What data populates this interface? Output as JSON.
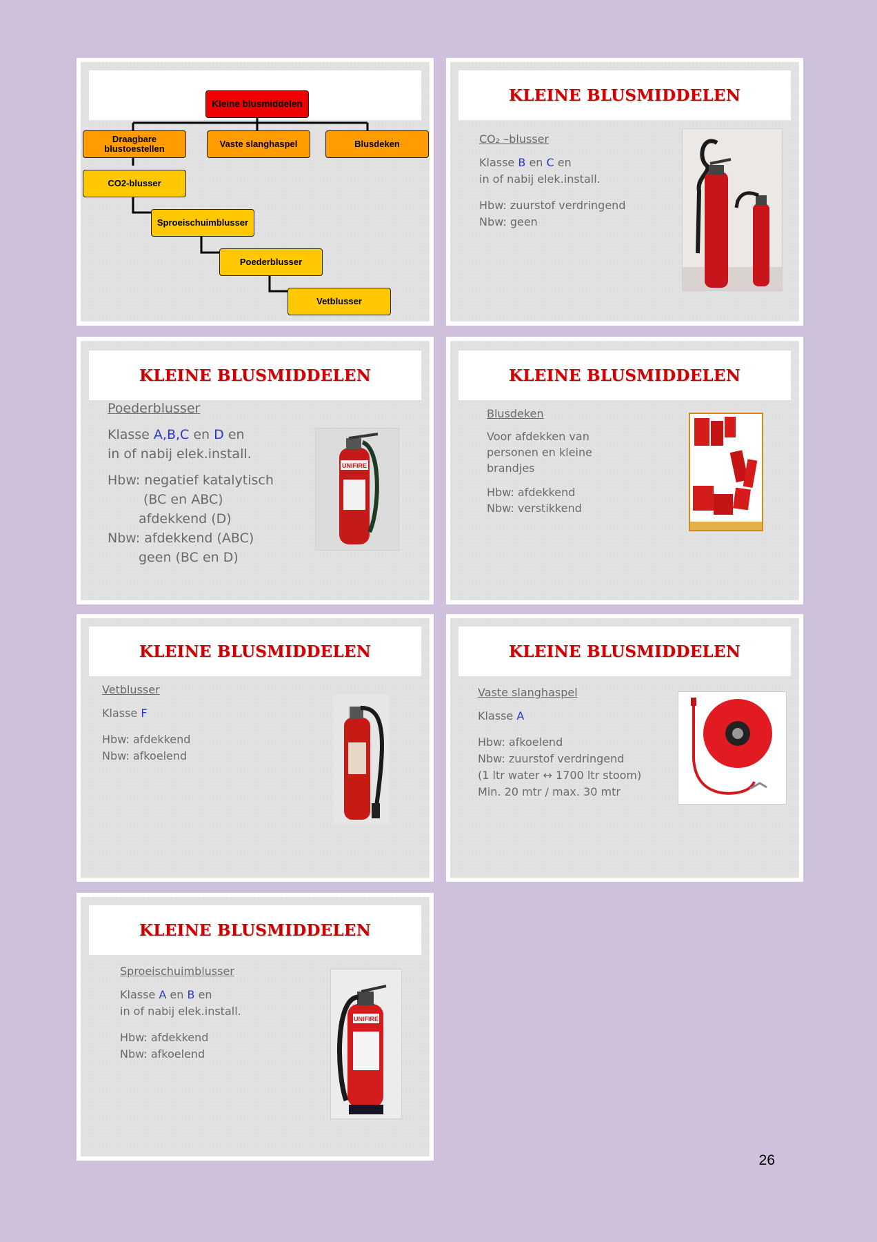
{
  "colors": {
    "background": "#cfc0dc",
    "title": "#d10000",
    "class_letters": "#2b38c8",
    "chart_root": "#f00000",
    "chart_level1": "#ff9c00",
    "chart_level2": "#ffc800"
  },
  "chart": {
    "root": "Kleine blusmiddelen",
    "level1": [
      "Draagbare blustoestellen",
      "Vaste slanghaspel",
      "Blusdeken"
    ],
    "extinguishers": [
      "CO2-blusser",
      "Sproeischuimblusser",
      "Poederblusser",
      "Vetblusser"
    ]
  },
  "slides": {
    "co2": {
      "title": "KLEINE BLUSMIDDELEN",
      "heading": "CO₂ –blusser",
      "klasse_label": "Klasse",
      "k1": "B",
      "en": "en",
      "k2": "C",
      "en2": "en",
      "line2": "in of nabij elek.install.",
      "hbw": "Hbw: zuurstof verdringend",
      "nbw": "Nbw: geen"
    },
    "poeder": {
      "title": "KLEINE BLUSMIDDELEN",
      "heading": "Poederblusser",
      "klasse_label": "Klasse",
      "k1": "A,B,C",
      "en": "en",
      "k2": "D",
      "en2": "en",
      "line2": "in of nabij elek.install.",
      "hbw": "Hbw: negatief katalytisch",
      "hbw2": "(BC en ABC)",
      "hbw3": "afdekkend (D)",
      "nbw": "Nbw: afdekkend (ABC)",
      "nbw2": "geen (BC en D)",
      "photo_brand": "UNIFIRE"
    },
    "deken": {
      "title": "KLEINE BLUSMIDDELEN",
      "heading": "Blusdeken",
      "l1": "Voor afdekken van",
      "l2": "personen en kleine",
      "l3": "brandjes",
      "hbw": "Hbw: afdekkend",
      "nbw": "Nbw: verstikkend"
    },
    "vet": {
      "title": "KLEINE BLUSMIDDELEN",
      "heading": "Vetblusser",
      "klasse_label": "Klasse",
      "k1": "F",
      "hbw": "Hbw: afdekkend",
      "nbw": "Nbw: afkoelend"
    },
    "haspel": {
      "title": "KLEINE BLUSMIDDELEN",
      "heading": "Vaste slanghaspel",
      "klasse_label": "Klasse",
      "k1": "A",
      "hbw": "Hbw: afkoelend",
      "nbw": "Nbw: zuurstof verdringend",
      "l3": "(1 ltr water ↔ 1700 ltr stoom)",
      "l4": "Min. 20 mtr / max. 30 mtr"
    },
    "schuim": {
      "title": "KLEINE BLUSMIDDELEN",
      "heading": "Sproeischuimblusser",
      "klasse_label": "Klasse",
      "k1": "A",
      "en": "en",
      "k2": "B",
      "en2": "en",
      "line2": "in of nabij elek.install.",
      "hbw": "Hbw: afdekkend",
      "nbw": "Nbw: afkoelend",
      "photo_brand": "UNIFIRE"
    }
  },
  "page_number": "26"
}
